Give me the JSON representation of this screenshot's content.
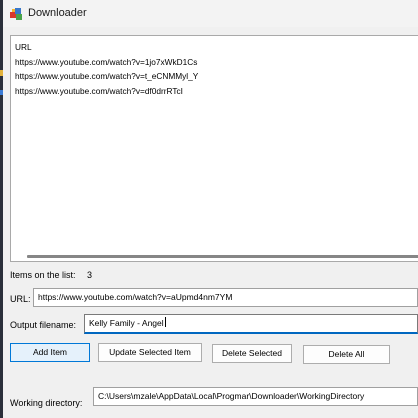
{
  "window": {
    "title": "Downloader",
    "icon": "app-icon"
  },
  "url_list": {
    "lines": [
      "URL",
      "https://www.youtube.com/watch?v=1jo7xWkD1Cs",
      "https://www.youtube.com/watch?v=t_eCNMMyl_Y",
      "https://www.youtube.com/watch?v=df0drrRTcI"
    ]
  },
  "items_count": {
    "label": "Items on the list:",
    "value": "3"
  },
  "url_field": {
    "label": "URL:",
    "value": "https://www.youtube.com/watch?v=aUpmd4nm7YM"
  },
  "output_filename": {
    "label": "Output filename:",
    "value": "Kelly Family - Angel"
  },
  "buttons": {
    "add_item": "Add Item",
    "update_selected": "Update Selected Item",
    "delete_selected": "Delete Selected",
    "delete_all": "Delete All"
  },
  "working_directory": {
    "label": "Working directory:",
    "value": "C:\\Users\\mzale\\AppData\\Local\\Progmar\\Downloader\\WorkingDirectory"
  },
  "colors": {
    "accent": "#0078d7",
    "default_button_bg": "#e5f1fb",
    "window_bg": "#f0f0f0"
  }
}
